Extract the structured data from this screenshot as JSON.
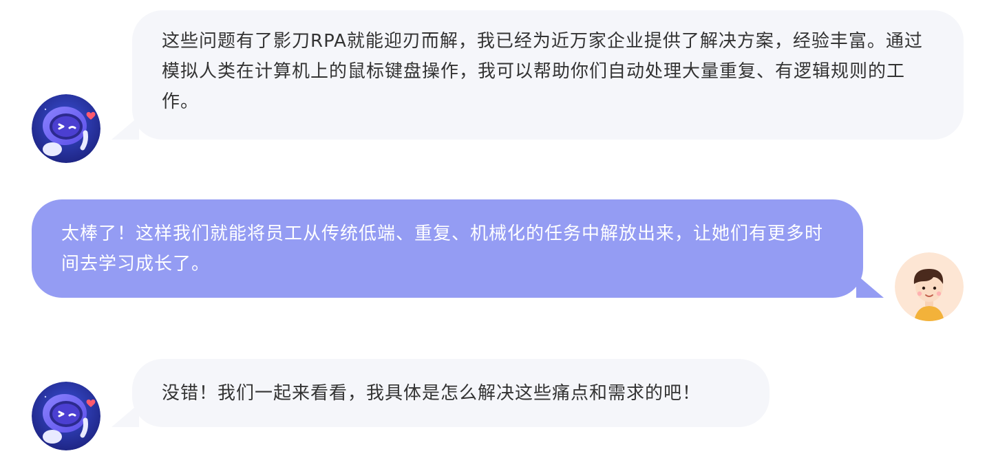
{
  "chat": {
    "messages": [
      {
        "sender": "bot",
        "avatar_icon": "robot-astronaut-avatar-icon",
        "text": "这些问题有了影刀RPA就能迎刃而解，我已经为近万家企业提供了解决方案，经验丰富。通过模拟人类在计算机上的鼠标键盘操作，我可以帮助你们自动处理大量重复、有逻辑规则的工作。"
      },
      {
        "sender": "user",
        "avatar_icon": "boy-user-avatar-icon",
        "text": "太棒了！这样我们就能将员工从传统低端、重复、机械化的任务中解放出来，让她们有更多时间去学习成长了。"
      },
      {
        "sender": "bot",
        "avatar_icon": "robot-astronaut-avatar-icon",
        "text": "没错！我们一起来看看，我具体是怎么解决这些痛点和需求的吧！"
      }
    ]
  },
  "colors": {
    "bot_bubble": "#f5f6fa",
    "bot_text": "#333333",
    "user_bubble": "#949cf3",
    "user_text": "#ffffff",
    "robot_accent": "#6f63f5",
    "heart": "#ff5a6e"
  }
}
